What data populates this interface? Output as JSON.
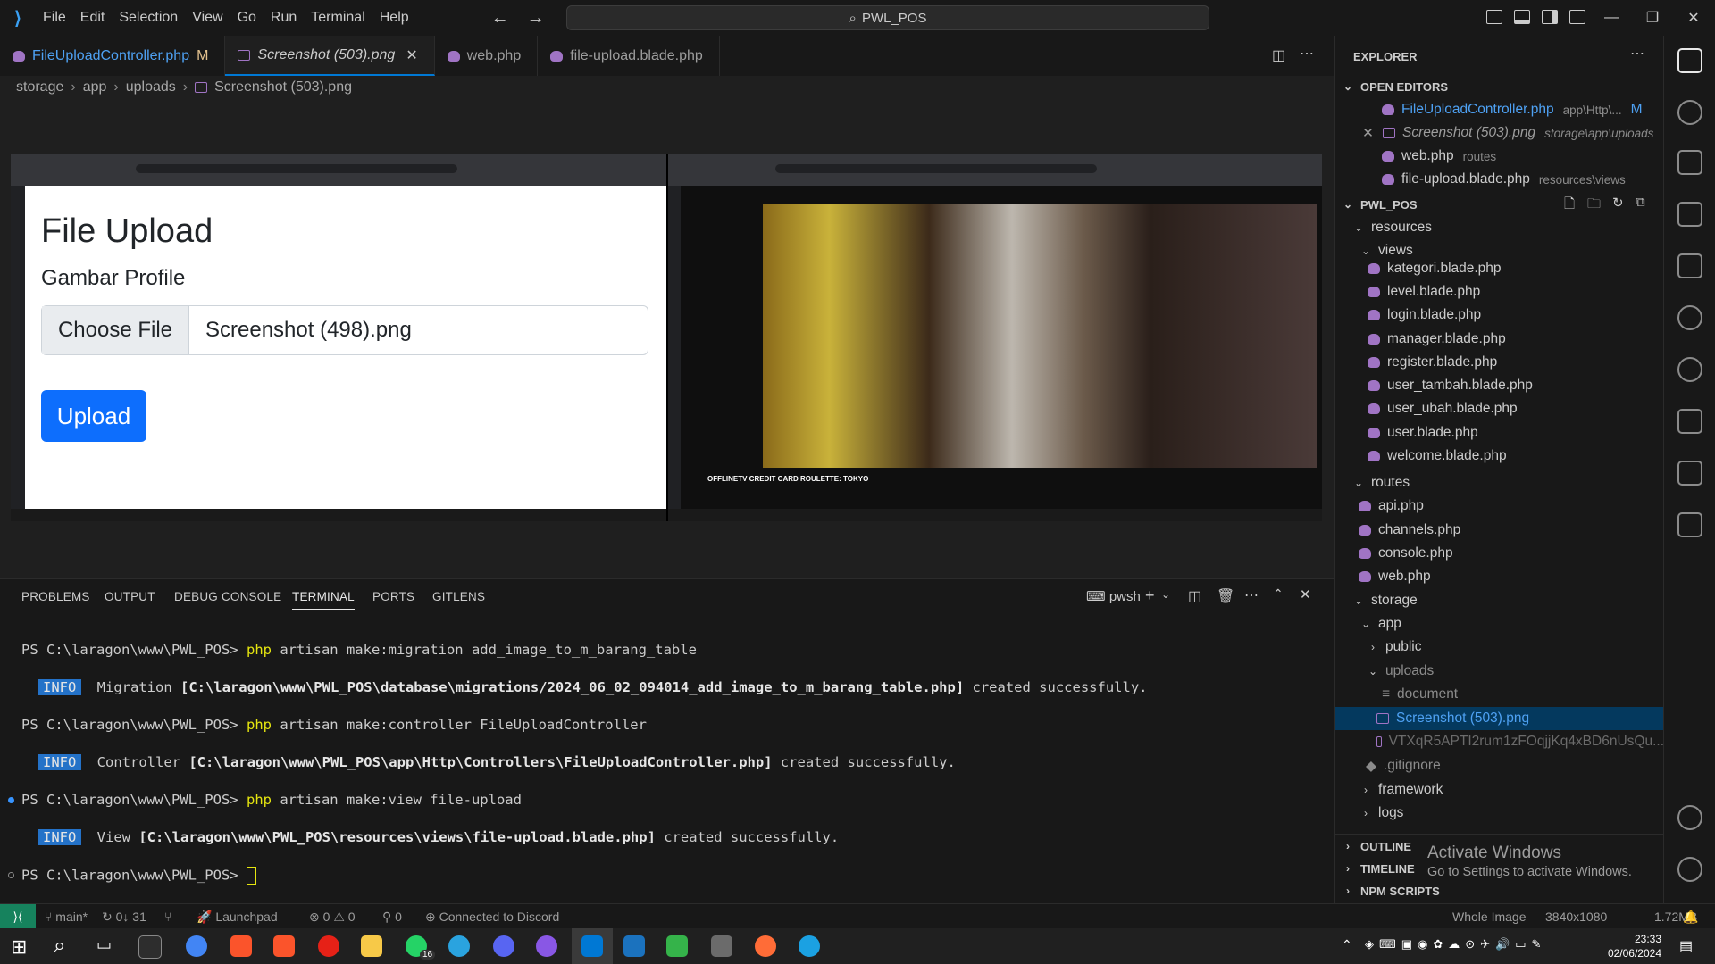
{
  "menu": [
    "File",
    "Edit",
    "Selection",
    "View",
    "Go",
    "Run",
    "Terminal",
    "Help"
  ],
  "search": {
    "label": "PWL_POS"
  },
  "tabs": [
    {
      "label": "FileUploadController.php",
      "badge": "M",
      "type": "php"
    },
    {
      "label": "Screenshot (503).png",
      "type": "image",
      "active": true
    },
    {
      "label": "web.php",
      "type": "php"
    },
    {
      "label": "file-upload.blade.php",
      "type": "php"
    }
  ],
  "breadcrumb": [
    "storage",
    "app",
    "uploads",
    "Screenshot (503).png"
  ],
  "preview": {
    "left": {
      "title": "File Upload",
      "label": "Gambar Profile",
      "choose": "Choose File",
      "filename": "Screenshot (498).png",
      "button": "Upload"
    },
    "right": {
      "video_title": "OFFLINETV CREDIT CARD ROULETTE: TOKYO"
    }
  },
  "panel": {
    "tabs": [
      "PROBLEMS",
      "OUTPUT",
      "DEBUG CONSOLE",
      "TERMINAL",
      "PORTS",
      "GITLENS"
    ],
    "active_tab": "TERMINAL",
    "shell": "pwsh",
    "lines": [
      {
        "prompt": "PS C:\\laragon\\www\\PWL_POS>",
        "cmd": "php",
        "args": " artisan make:migration add_image_to_m_barang_table"
      },
      {
        "badge": "INFO",
        "pre": " Migration ",
        "bold": "[C:\\laragon\\www\\PWL_POS\\database\\migrations/2024_06_02_094014_add_image_to_m_barang_table.php]",
        "post": " created successfully."
      },
      {
        "prompt": "PS C:\\laragon\\www\\PWL_POS>",
        "cmd": "php",
        "args": " artisan make:controller FileUploadController"
      },
      {
        "badge": "INFO",
        "pre": " Controller ",
        "bold": "[C:\\laragon\\www\\PWL_POS\\app\\Http\\Controllers\\FileUploadController.php]",
        "post": " created successfully."
      },
      {
        "prompt": "PS C:\\laragon\\www\\PWL_POS>",
        "cmd": "php",
        "args": " artisan make:view file-upload"
      },
      {
        "badge": "INFO",
        "pre": " View ",
        "bold": "[C:\\laragon\\www\\PWL_POS\\resources\\views\\file-upload.blade.php]",
        "post": " created successfully."
      },
      {
        "prompt": "PS C:\\laragon\\www\\PWL_POS>"
      }
    ]
  },
  "explorer": {
    "title": "EXPLORER",
    "open_editors_label": "OPEN EDITORS",
    "open_editors": [
      {
        "name": "FileUploadController.php",
        "hint": "app\\Http\\...",
        "badge": "M"
      },
      {
        "name": "Screenshot (503).png",
        "hint": "storage\\app\\uploads"
      },
      {
        "name": "web.php",
        "hint": "routes"
      },
      {
        "name": "file-upload.blade.php",
        "hint": "resources\\views"
      }
    ],
    "project": "PWL_POS",
    "tree": {
      "resources": "resources",
      "views": "views",
      "view_files": [
        "kategori.blade.php",
        "level.blade.php",
        "login.blade.php",
        "manager.blade.php",
        "register.blade.php",
        "user_tambah.blade.php",
        "user_ubah.blade.php",
        "user.blade.php",
        "welcome.blade.php"
      ],
      "routes": "routes",
      "route_files": [
        "api.php",
        "channels.php",
        "console.php",
        "web.php"
      ],
      "storage": "storage",
      "app": "app",
      "public": "public",
      "uploads": "uploads",
      "upload_files": [
        "document",
        "Screenshot (503).png",
        "VTXqR5APTI2rum1zFOqjjKq4xBD6nUsQu..."
      ],
      "gitignore": ".gitignore",
      "framework": "framework",
      "logs": "logs"
    },
    "outline": "OUTLINE",
    "timeline": "TIMELINE",
    "npm": "NPM SCRIPTS"
  },
  "watermark": {
    "title": "Activate Windows",
    "sub": "Go to Settings to activate Windows."
  },
  "status": {
    "branch": "main*",
    "sync": "0↓ 31",
    "launchpad": "Launchpad",
    "errors": "0",
    "warnings": "0",
    "ports": "0",
    "discord": "Connected to Discord",
    "image": "Whole Image",
    "dims": "3840x1080",
    "size": "1.72MB"
  },
  "taskbar": {
    "time": "23:33",
    "date": "02/06/2024",
    "badge": "16"
  }
}
